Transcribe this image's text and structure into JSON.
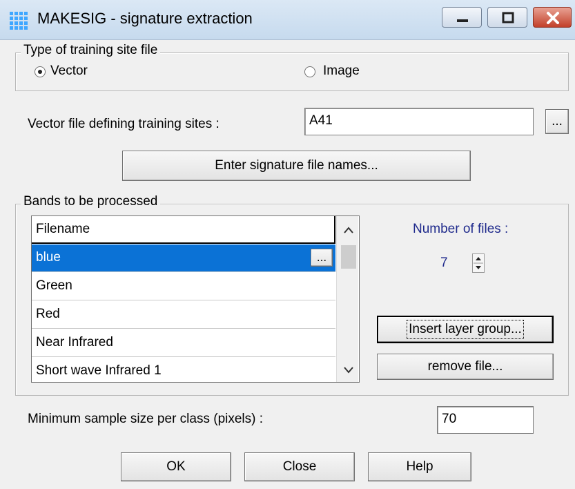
{
  "window": {
    "title": "MAKESIG - signature extraction"
  },
  "training_type": {
    "legend": "Type of training site file",
    "options": [
      {
        "label": "Vector",
        "checked": true
      },
      {
        "label": "Image",
        "checked": false
      }
    ]
  },
  "vector_file": {
    "label": "Vector file defining training sites :",
    "value": "A41",
    "browse_label": "..."
  },
  "enter_sig_button": "Enter signature file names...",
  "bands": {
    "legend": "Bands to be processed",
    "column_header": "Filename",
    "rows": [
      "blue",
      "Green",
      "Red",
      "Near Infrared",
      "Short wave Infrared 1"
    ],
    "selected_index": 0,
    "row_browse_label": "...",
    "number_of_files_label": "Number of files :",
    "number_of_files_value": "7",
    "insert_layer_group_label": "Insert layer group...",
    "remove_file_label": "remove file..."
  },
  "min_sample": {
    "label": "Minimum sample size per class (pixels) :",
    "value": "70"
  },
  "footer": {
    "ok_label": "OK",
    "close_label": "Close",
    "help_label": "Help"
  },
  "colors": {
    "selection": "#0b72d6",
    "number_text": "#1f2a8c",
    "title_bar": "#c6daee"
  },
  "icons": [
    "app-grid-icon",
    "minimize-icon",
    "maximize-icon",
    "close-icon",
    "scroll-up-icon",
    "scroll-down-icon",
    "spin-up-icon",
    "spin-down-icon"
  ]
}
